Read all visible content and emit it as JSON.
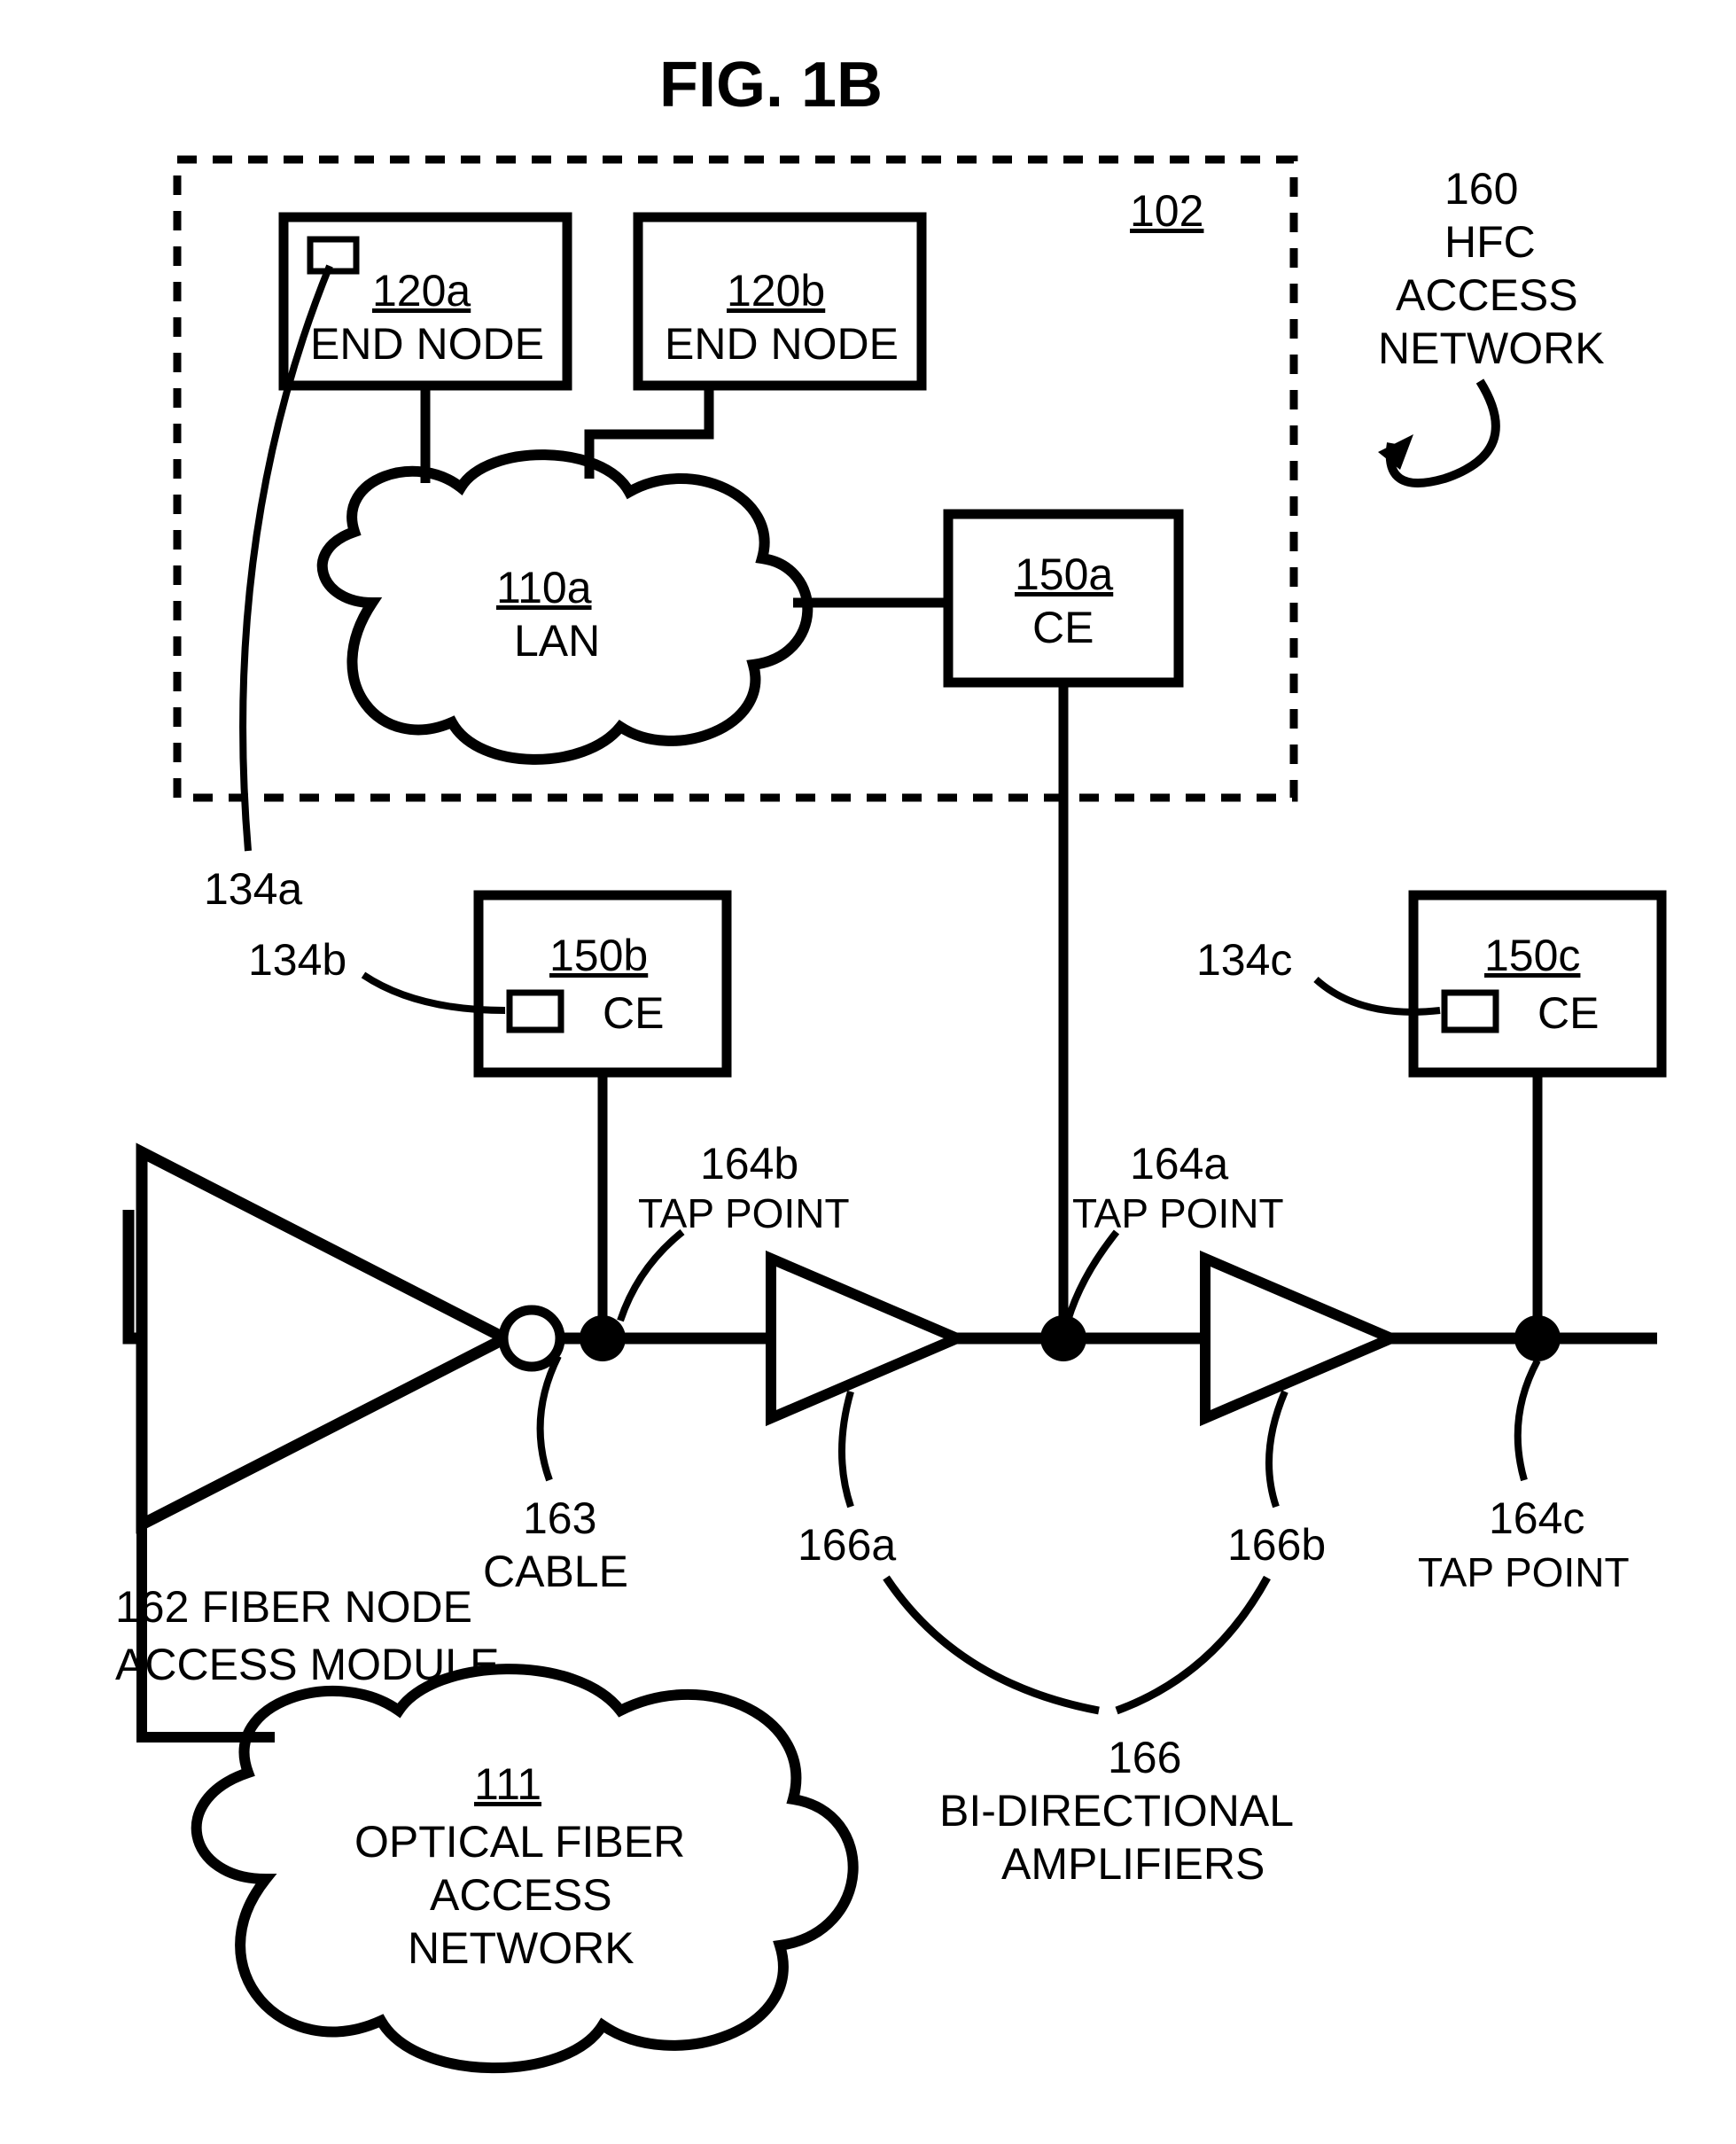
{
  "title": "FIG. 1B",
  "callout_102": "102",
  "hfc": {
    "ref": "160",
    "line1": "HFC",
    "line2": "ACCESS",
    "line3": "NETWORK"
  },
  "end_node_a": {
    "ref": "120a",
    "label": "END NODE"
  },
  "end_node_b": {
    "ref": "120b",
    "label": "END NODE"
  },
  "lan": {
    "ref": "110a",
    "label": "LAN"
  },
  "ce_a": {
    "ref": "150a",
    "label": "CE"
  },
  "ce_b": {
    "ref": "150b",
    "label": "CE"
  },
  "ce_c": {
    "ref": "150c",
    "label": "CE"
  },
  "ref_134a": "134a",
  "ref_134b": "134b",
  "ref_134c": "134c",
  "tap_a": {
    "ref": "164a",
    "label": "TAP POINT"
  },
  "tap_b": {
    "ref": "164b",
    "label": "TAP POINT"
  },
  "tap_c": {
    "ref": "164c",
    "label": "TAP POINT"
  },
  "cable": {
    "ref": "163",
    "label": "CABLE"
  },
  "fiber_node": {
    "ref": "162",
    "label1": "FIBER NODE",
    "label2": "ACCESS MODULE"
  },
  "amps": {
    "ref": "166",
    "label1": "BI-DIRECTIONAL",
    "label2": "AMPLIFIERS"
  },
  "amp_a": "166a",
  "amp_b": "166b",
  "optical": {
    "ref": "111",
    "line1": "OPTICAL FIBER",
    "line2": "ACCESS",
    "line3": "NETWORK"
  }
}
